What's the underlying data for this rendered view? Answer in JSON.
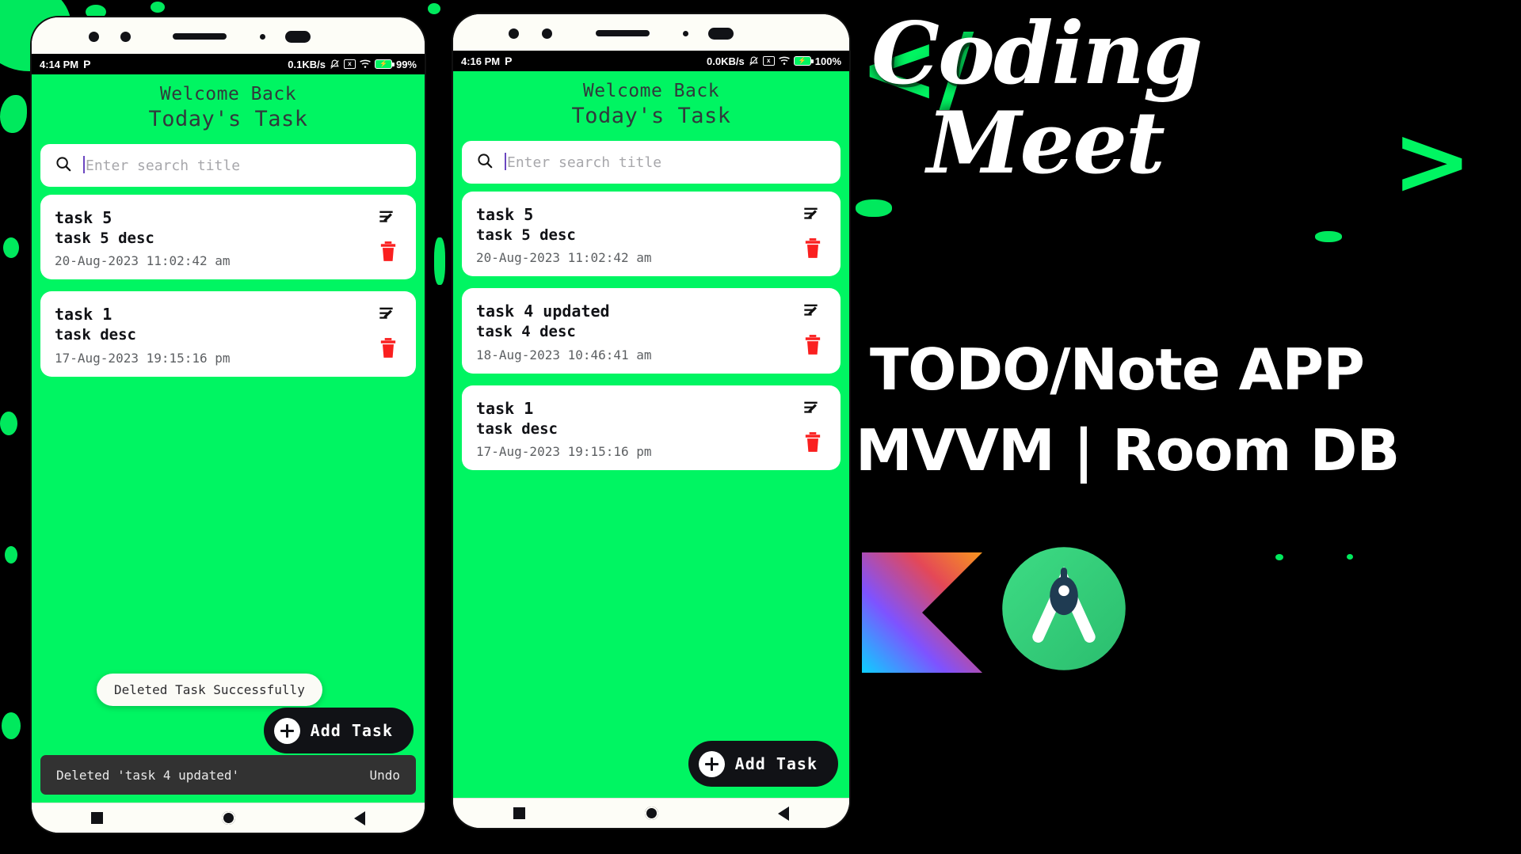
{
  "phones": [
    {
      "id": "phone-left",
      "status_bar": {
        "time": "4:14 PM",
        "app_badge": "P",
        "network_speed": "0.1KB/s",
        "mute_icon": "bell-muted-icon",
        "x_icon": "sim-off-icon",
        "wifi_icon": "wifi-icon",
        "battery_icon": "battery-charging-icon",
        "battery_level": "99%"
      },
      "header": {
        "welcome": "Welcome Back",
        "title": "Today's Task"
      },
      "search": {
        "icon": "search-icon",
        "placeholder": "Enter search title",
        "value": ""
      },
      "tasks": [
        {
          "title": "task 5",
          "desc": "task 5 desc",
          "date": "20-Aug-2023 11:02:42 am",
          "edit_icon": "edit-note-icon",
          "delete_icon": "trash-icon"
        },
        {
          "title": "task 1",
          "desc": "task desc",
          "date": "17-Aug-2023 19:15:16 pm",
          "edit_icon": "edit-note-icon",
          "delete_icon": "trash-icon"
        }
      ],
      "toast": "Deleted Task Successfully",
      "fab": {
        "label": "Add Task",
        "icon": "plus-circle-icon"
      },
      "snackbar": {
        "text": "Deleted 'task 4 updated'",
        "action": "Undo"
      },
      "navbar": {
        "recent_icon": "square-icon",
        "home_icon": "circle-icon",
        "back_icon": "triangle-back-icon"
      }
    },
    {
      "id": "phone-right",
      "status_bar": {
        "time": "4:16 PM",
        "app_badge": "P",
        "network_speed": "0.0KB/s",
        "mute_icon": "bell-muted-icon",
        "x_icon": "sim-off-icon",
        "wifi_icon": "wifi-icon",
        "battery_icon": "battery-charging-icon",
        "battery_level": "100%"
      },
      "header": {
        "welcome": "Welcome Back",
        "title": "Today's Task"
      },
      "search": {
        "icon": "search-icon",
        "placeholder": "Enter search title",
        "value": ""
      },
      "tasks": [
        {
          "title": "task 5",
          "desc": "task 5 desc",
          "date": "20-Aug-2023 11:02:42 am",
          "edit_icon": "edit-note-icon",
          "delete_icon": "trash-icon"
        },
        {
          "title": "task 4 updated",
          "desc": "task 4 desc",
          "date": "18-Aug-2023 10:46:41 am",
          "edit_icon": "edit-note-icon",
          "delete_icon": "trash-icon"
        },
        {
          "title": "task 1",
          "desc": "task desc",
          "date": "17-Aug-2023 19:15:16 pm",
          "edit_icon": "edit-note-icon",
          "delete_icon": "trash-icon"
        }
      ],
      "toast": "",
      "fab": {
        "label": "Add Task",
        "icon": "plus-circle-icon"
      },
      "snackbar": null,
      "navbar": {
        "recent_icon": "square-icon",
        "home_icon": "circle-icon",
        "back_icon": "triangle-back-icon"
      }
    }
  ],
  "branding": {
    "logo_line1": "Coding",
    "logo_line2": "Meet",
    "angle_open": "</",
    "angle_close": ">",
    "title_line1": "TODO/Note APP",
    "title_line2": "MVVM | Room DB",
    "kotlin_logo": "kotlin-logo",
    "android_studio_logo": "android-studio-logo"
  },
  "colors": {
    "accent_green": "#00f562",
    "background": "#000000",
    "card_white": "#ffffff",
    "delete_red": "#fa1f1f",
    "text_dark": "#31393c",
    "snackbar_bg": "#323232"
  }
}
